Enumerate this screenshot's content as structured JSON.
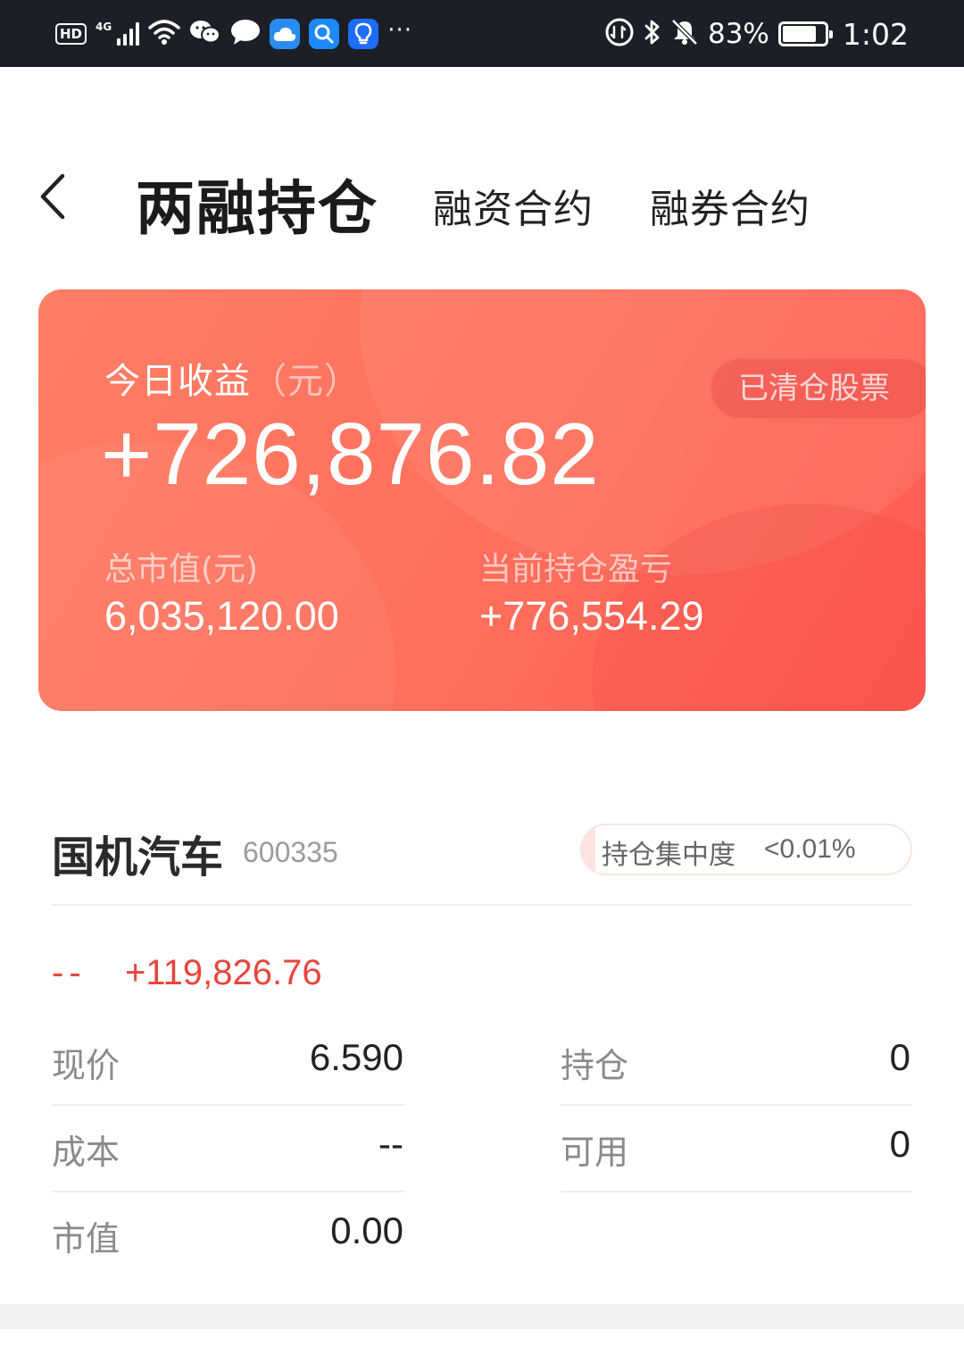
{
  "status_bar": {
    "hd": "HD",
    "network": "4G",
    "battery_pct": "83%",
    "battery_level": 0.83,
    "time": "1:02",
    "more": "···",
    "icons": [
      "hd-icon",
      "signal-icon",
      "wifi-icon",
      "wechat-icon",
      "message-icon",
      "cloud-app-icon",
      "search-app-icon",
      "bulb-app-icon",
      "more-icon",
      "data-icon",
      "bluetooth-icon",
      "mute-icon",
      "battery-icon"
    ]
  },
  "nav": {
    "back_icon": "chevron-left-icon",
    "title": "两融持仓",
    "tabs": [
      {
        "label": "融资合约"
      },
      {
        "label": "融券合约"
      }
    ]
  },
  "summary": {
    "today_label": "今日收益",
    "today_unit": "（元）",
    "today_value": "+726,876.82",
    "cleared_button": "已清仓股票",
    "market_value_label": "总市值(元)",
    "market_value": "6,035,120.00",
    "pnl_label": "当前持仓盈亏",
    "pnl_value": "+776,554.29"
  },
  "holding": {
    "name": "国机汽车",
    "code": "600335",
    "concentration_label": "持仓集中度",
    "concentration_value": "<0.01%",
    "pl_placeholder": "--",
    "pl_value": "+119,826.76",
    "left_fields": [
      {
        "label": "现价",
        "value": "6.590"
      },
      {
        "label": "成本",
        "value": "--"
      },
      {
        "label": "市值",
        "value": "0.00"
      }
    ],
    "right_fields": [
      {
        "label": "持仓",
        "value": "0"
      },
      {
        "label": "可用",
        "value": "0"
      }
    ]
  },
  "colors": {
    "status_bar_bg": "#1c1f26",
    "card_gradient_start": "#ff7e66",
    "card_gradient_end": "#ff5a52",
    "profit_red": "#e8453c",
    "label_gray": "#8a8a8a",
    "divider": "#eeeeee"
  }
}
